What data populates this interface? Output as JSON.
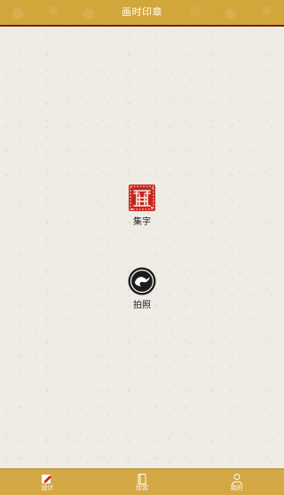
{
  "header": {
    "title": "画时印章"
  },
  "main": {
    "actions": [
      {
        "label": "集字",
        "icon": "seal-stamp-icon"
      },
      {
        "label": "拍照",
        "icon": "camera-icon"
      }
    ]
  },
  "tabbar": {
    "tabs": [
      {
        "label": "设计",
        "icon": "pencil-edit-icon",
        "active": true
      },
      {
        "label": "欣赏",
        "icon": "book-icon",
        "active": false
      },
      {
        "label": "我的",
        "icon": "user-icon",
        "active": false
      }
    ]
  },
  "colors": {
    "header_bg": "#d1a63a",
    "header_border": "#7a1f10",
    "paper_bg": "#efece6",
    "seal_red": "#c8241c",
    "tabbar_bg": "#d4a844"
  }
}
